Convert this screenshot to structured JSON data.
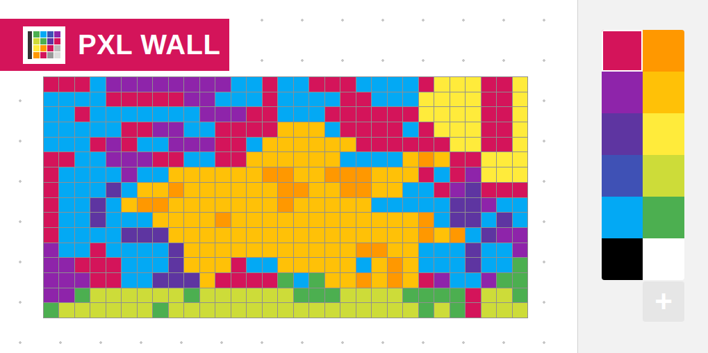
{
  "header": {
    "title": "PXL WALL"
  },
  "palette": [
    {
      "color": "#d4145a",
      "selected": true
    },
    {
      "color": "#ff9800",
      "selected": false
    },
    {
      "color": "#8e24aa",
      "selected": false
    },
    {
      "color": "#ffc107",
      "selected": false
    },
    {
      "color": "#5e35a1",
      "selected": false
    },
    {
      "color": "#ffeb3b",
      "selected": false
    },
    {
      "color": "#3f51b5",
      "selected": false
    },
    {
      "color": "#cddc39",
      "selected": false
    },
    {
      "color": "#03a9f4",
      "selected": false
    },
    {
      "color": "#4caf50",
      "selected": false
    },
    {
      "color": "#000000",
      "selected": false
    },
    {
      "color": "#ffffff",
      "selected": false
    }
  ],
  "add_button": {
    "label": "+"
  },
  "wall": {
    "rows": [
      [
        0,
        0,
        0,
        8,
        2,
        2,
        2,
        2,
        2,
        2,
        2,
        2,
        8,
        8,
        0,
        8,
        8,
        0,
        0,
        0,
        8,
        8,
        8,
        8,
        0,
        5,
        5,
        5,
        0,
        0,
        5
      ],
      [
        8,
        8,
        8,
        8,
        0,
        0,
        0,
        0,
        0,
        2,
        2,
        8,
        8,
        8,
        0,
        8,
        8,
        8,
        8,
        0,
        0,
        8,
        8,
        8,
        5,
        5,
        5,
        5,
        0,
        0,
        5
      ],
      [
        8,
        8,
        0,
        8,
        8,
        8,
        8,
        8,
        8,
        8,
        2,
        2,
        2,
        0,
        0,
        8,
        8,
        8,
        0,
        0,
        0,
        0,
        0,
        0,
        5,
        5,
        5,
        5,
        0,
        0,
        5
      ],
      [
        8,
        8,
        8,
        8,
        8,
        0,
        0,
        2,
        2,
        8,
        8,
        0,
        0,
        0,
        0,
        3,
        3,
        3,
        8,
        0,
        0,
        0,
        0,
        8,
        0,
        5,
        5,
        5,
        0,
        0,
        5
      ],
      [
        8,
        8,
        8,
        0,
        2,
        0,
        8,
        8,
        2,
        2,
        2,
        0,
        0,
        8,
        3,
        3,
        3,
        3,
        3,
        3,
        0,
        0,
        0,
        0,
        0,
        0,
        5,
        5,
        0,
        0,
        5
      ],
      [
        0,
        0,
        8,
        8,
        2,
        2,
        2,
        0,
        0,
        8,
        8,
        0,
        0,
        3,
        3,
        3,
        3,
        3,
        3,
        8,
        8,
        8,
        8,
        3,
        1,
        3,
        0,
        0,
        5,
        5,
        5
      ],
      [
        0,
        8,
        8,
        8,
        8,
        2,
        8,
        8,
        3,
        3,
        3,
        3,
        3,
        3,
        1,
        1,
        3,
        3,
        1,
        1,
        1,
        3,
        3,
        3,
        0,
        8,
        0,
        2,
        5,
        5,
        5
      ],
      [
        0,
        8,
        8,
        8,
        4,
        8,
        3,
        3,
        1,
        3,
        3,
        3,
        3,
        3,
        3,
        1,
        1,
        3,
        3,
        1,
        1,
        3,
        3,
        8,
        8,
        0,
        2,
        4,
        0,
        0,
        0
      ],
      [
        0,
        8,
        8,
        4,
        8,
        3,
        1,
        1,
        3,
        3,
        3,
        3,
        3,
        3,
        3,
        1,
        3,
        3,
        3,
        3,
        3,
        8,
        8,
        8,
        8,
        8,
        4,
        4,
        2,
        8,
        8
      ],
      [
        0,
        8,
        8,
        4,
        8,
        8,
        8,
        3,
        3,
        3,
        3,
        1,
        3,
        3,
        3,
        3,
        3,
        3,
        3,
        3,
        3,
        3,
        3,
        3,
        1,
        8,
        4,
        4,
        8,
        4,
        8
      ],
      [
        0,
        8,
        8,
        8,
        8,
        4,
        4,
        4,
        3,
        3,
        3,
        3,
        3,
        3,
        3,
        3,
        3,
        3,
        3,
        3,
        3,
        3,
        3,
        3,
        1,
        3,
        1,
        8,
        4,
        2,
        2
      ],
      [
        2,
        8,
        8,
        0,
        8,
        8,
        8,
        8,
        4,
        3,
        3,
        3,
        3,
        3,
        3,
        3,
        3,
        3,
        3,
        3,
        1,
        1,
        3,
        3,
        8,
        8,
        8,
        4,
        8,
        8,
        2
      ],
      [
        2,
        2,
        0,
        0,
        0,
        8,
        8,
        8,
        4,
        3,
        3,
        3,
        0,
        8,
        8,
        3,
        3,
        3,
        3,
        3,
        8,
        3,
        1,
        3,
        8,
        8,
        8,
        4,
        8,
        8,
        9
      ],
      [
        2,
        2,
        2,
        0,
        0,
        8,
        8,
        4,
        4,
        4,
        3,
        0,
        0,
        0,
        0,
        9,
        8,
        9,
        3,
        3,
        1,
        3,
        1,
        3,
        0,
        2,
        8,
        8,
        2,
        9,
        9
      ],
      [
        2,
        2,
        9,
        7,
        7,
        7,
        7,
        7,
        7,
        9,
        7,
        7,
        7,
        7,
        7,
        7,
        9,
        9,
        9,
        7,
        7,
        7,
        7,
        9,
        9,
        9,
        9,
        0,
        7,
        7,
        9
      ],
      [
        9,
        7,
        7,
        7,
        7,
        7,
        7,
        9,
        7,
        7,
        7,
        7,
        7,
        7,
        7,
        7,
        7,
        7,
        7,
        7,
        7,
        7,
        7,
        7,
        9,
        7,
        9,
        0,
        7,
        7,
        7
      ]
    ]
  }
}
